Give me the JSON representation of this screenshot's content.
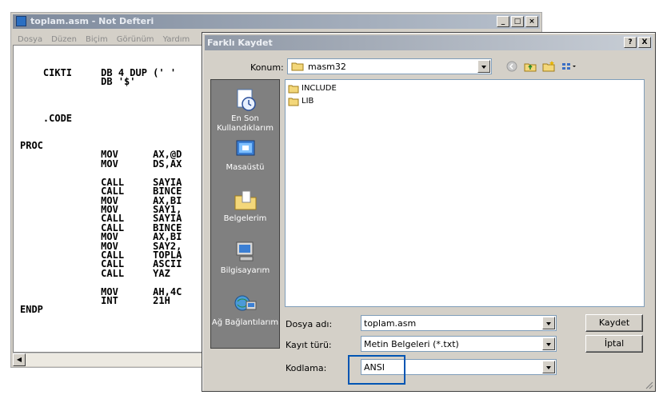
{
  "notepad": {
    "title": "toplam.asm - Not Defteri",
    "menu": [
      "Dosya",
      "Düzen",
      "Biçim",
      "Görünüm",
      "Yardım"
    ],
    "code": "\n\n    CIKTI     DB 4 DUP (' '\n              DB '$'\n\n\n\n    .CODE\n\n\nPROC\n              MOV      AX,@D\n              MOV      DS,AX\n\n              CALL     SAYIA\n              CALL     BINCE\n              MOV      AX,BI\n              MOV      SAY1,\n              CALL     SAYIA\n              CALL     BINCE\n              MOV      AX,BI\n              MOV      SAY2,\n              CALL     TOPLA\n              CALL     ASCII\n              CALL     YAZ\n\n              MOV      AH,4C\n              INT      21H\nENDP"
  },
  "dialog": {
    "title": "Farklı Kaydet",
    "help_btn": "?",
    "close_btn": "X",
    "konum_label": "Konum:",
    "konum_value": "masm32",
    "places": [
      "En Son Kullandıklarım",
      "Masaüstü",
      "Belgelerim",
      "Bilgisayarım",
      "Ağ Bağlantılarım"
    ],
    "files": [
      "INCLUDE",
      "LIB"
    ],
    "dosya_adi_label": "Dosya adı:",
    "dosya_adi_value": "toplam.asm",
    "kayit_turu_label": "Kayıt türü:",
    "kayit_turu_value": "Metin Belgeleri (*.txt)",
    "kodlama_label": "Kodlama:",
    "kodlama_value": "ANSI",
    "save_btn": "Kaydet",
    "cancel_btn": "İptal"
  },
  "colors": {
    "highlight_border": "#0055b3",
    "places_bg": "#808080"
  }
}
